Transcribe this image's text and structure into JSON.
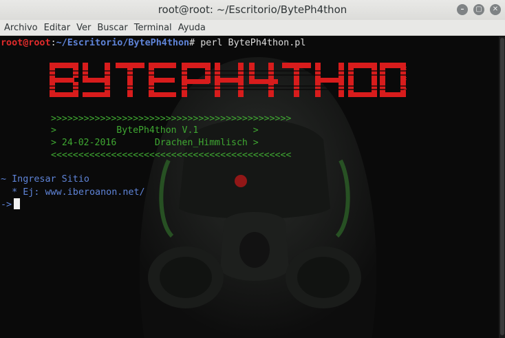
{
  "window": {
    "title": "root@root: ~/Escritorio/BytePh4thon"
  },
  "menu": [
    "Archivo",
    "Editar",
    "Ver",
    "Buscar",
    "Terminal",
    "Ayuda"
  ],
  "terminal": {
    "prompt_user": "root@root",
    "prompt_sep": ":",
    "prompt_path": "~/Escritorio/BytePh4thon",
    "prompt_hash": "#",
    "command": " perl BytePh4thon.pl",
    "logo_text": "BytePh4thon",
    "banner": {
      "border_top": ">>>>>>>>>>>>>>>>>>>>>>>>>>>>>>>>>>>>>>>>>>>>",
      "line1": ">           BytePh4thon V.1          >",
      "line2": "> 24-02-2016       Drachen_Himmlisch >",
      "border_bottom": "<<<<<<<<<<<<<<<<<<<<<<<<<<<<<<<<<<<<<<<<<<<<"
    },
    "ingresar": "~ Ingresar Sitio",
    "example": "  * Ej: www.iberoanon.net/",
    "input_prompt": "->"
  },
  "colors": {
    "prompt_red": "#e02b2b",
    "info_blue": "#5f84d8",
    "banner_green": "#49b43a",
    "logo_red": "#d81c1c"
  }
}
